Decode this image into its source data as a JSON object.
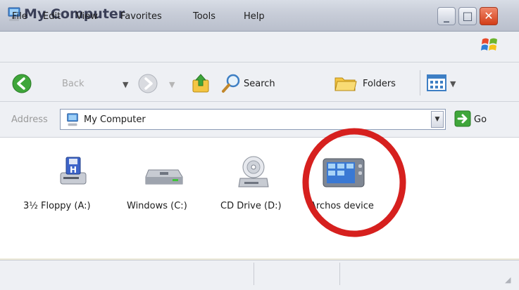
{
  "window": {
    "title": "My Computer"
  },
  "menu": {
    "items": [
      "File",
      "Edit",
      "View",
      "Favorites",
      "Tools",
      "Help"
    ]
  },
  "toolbar": {
    "back_label": "Back",
    "search_label": "Search",
    "folders_label": "Folders"
  },
  "address": {
    "label": "Address",
    "value": "My Computer",
    "go_label": "Go"
  },
  "drives": [
    {
      "label": "3½ Floppy (A:)",
      "icon": "floppy-drive-icon"
    },
    {
      "label": "Windows (C:)",
      "icon": "hard-drive-icon"
    },
    {
      "label": "CD Drive (D:)",
      "icon": "cd-drive-icon"
    },
    {
      "label": "Archos device",
      "icon": "archos-device-icon"
    }
  ],
  "colors": {
    "highlight": "#d6201e",
    "title_text": "#3a3f57",
    "close_button": "#d33d17"
  }
}
